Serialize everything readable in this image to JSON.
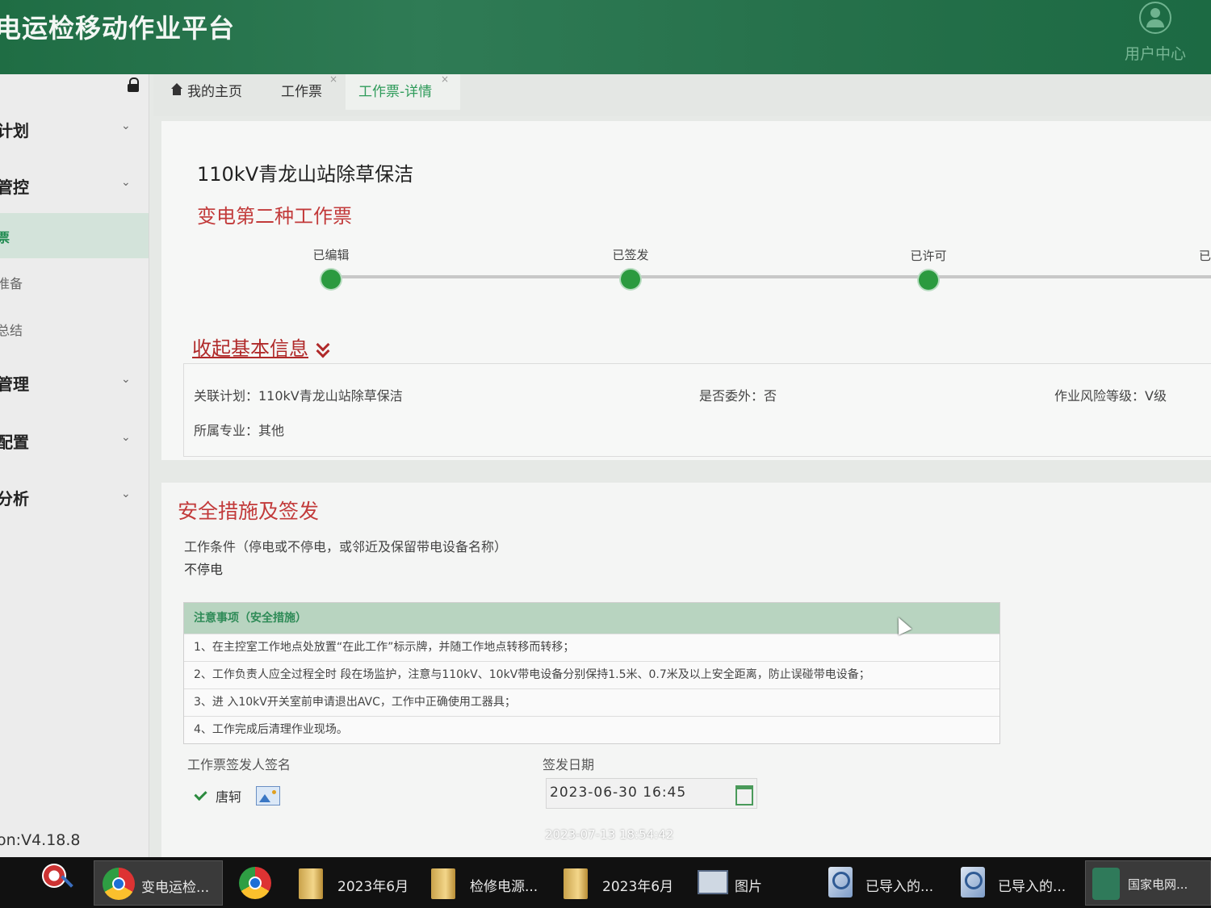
{
  "header": {
    "app_title": "电运检移动作业平台",
    "user_center": "用户中心"
  },
  "sidebar": {
    "items": [
      {
        "label": "计划",
        "expandable": true
      },
      {
        "label": "管控",
        "expandable": true
      },
      {
        "label": "票",
        "active": true
      },
      {
        "label": "准备"
      },
      {
        "label": "总结"
      },
      {
        "label": "管理",
        "expandable": true
      },
      {
        "label": "配置",
        "expandable": true
      },
      {
        "label": "分析",
        "expandable": true
      }
    ],
    "version": "on:V4.18.8"
  },
  "tabs": [
    {
      "label": "我的主页"
    },
    {
      "label": "工作票",
      "close": "×"
    },
    {
      "label": "工作票-详情",
      "active": true,
      "close": "×"
    }
  ],
  "detail": {
    "title": "110kV青龙山站除草保洁",
    "ticket_type": "变电第二种工作票",
    "steps": [
      "已编辑",
      "已签发",
      "已许可",
      "已"
    ],
    "collapse_label": "收起基本信息",
    "info": {
      "related_plan": "关联计划：110kV青龙山站除草保洁",
      "outsourced": "是否委外：否",
      "risk_level": "作业风险等级：Ⅴ级",
      "specialty": "所属专业：其他"
    }
  },
  "safety": {
    "section_title": "安全措施及签发",
    "condition_label": "工作条件（停电或不停电，或邻近及保留带电设备名称）",
    "condition_value": "不停电",
    "precautions_header": "注意事项（安全措施）",
    "precautions": [
      "1、在主控室工作地点处放置“在此工作”标示牌，并随工作地点转移而转移；",
      "2、工作负责人应全过程全时 段在场监护，注意与110kV、10kV带电设备分别保持1.5米、0.7米及以上安全距离，防止误碰带电设备；",
      "3、进 入10kV开关室前申请退出AVC，工作中正确使用工器具；",
      "4、工作完成后清理作业现场。"
    ],
    "signer_label": "工作票签发人签名",
    "signer_name": "唐轲",
    "date_label": "签发日期",
    "date_value": "2023-06-30 16:45"
  },
  "timestamp": "2023-07-13 18:54:42",
  "taskbar": {
    "items": [
      {
        "label": "变电运检...",
        "icon": "chrome-icon",
        "active": true
      },
      {
        "label": "",
        "icon": "chrome-icon"
      },
      {
        "label": "2023年6月",
        "icon": "folder-icon"
      },
      {
        "label": "检修电源...",
        "icon": "folder-icon"
      },
      {
        "label": "2023年6月",
        "icon": "folder-icon"
      },
      {
        "label": "图片",
        "icon": "pictures-icon"
      },
      {
        "label": "已导入的...",
        "icon": "import-icon"
      },
      {
        "label": "已导入的...",
        "icon": "import-icon"
      },
      {
        "label": "国家电网...",
        "icon": "sgcc-icon"
      }
    ]
  },
  "colors": {
    "header_green": "#1f6d44",
    "accent_red": "#c23a3a",
    "tab_active_green": "#2e9b5a",
    "step_green": "#2b9a3f"
  }
}
